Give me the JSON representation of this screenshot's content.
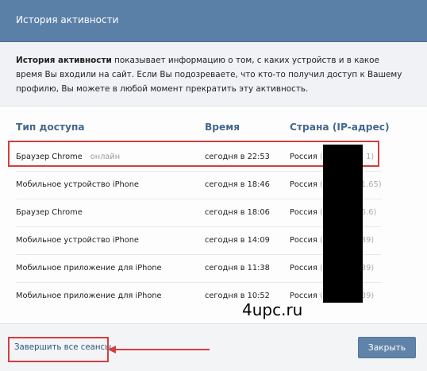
{
  "header": {
    "title": "История активности"
  },
  "info": {
    "bold": "История активности",
    "text": " показывает информацию о том, с каких устройств и в какое время Вы входили на сайт. Если Вы подозреваете, что кто-то получил доступ к Вашему профилю, Вы можете в любой момент прекратить эту активность."
  },
  "table": {
    "headers": {
      "device": "Тип доступа",
      "time": "Время",
      "country": "Страна (IP-адрес)"
    },
    "rows": [
      {
        "device": "Браузер Chrome",
        "status": "онлайн",
        "time": "сегодня в 22:53",
        "country": "Россия",
        "ip_prefix": " (5",
        "ip_suffix": "1)"
      },
      {
        "device": "Мобильное устройство iPhone",
        "status": "",
        "time": "сегодня в 18:46",
        "country": "Россия",
        "ip_prefix": " (",
        "ip_suffix": "1.65)"
      },
      {
        "device": "Браузер Chrome",
        "status": "",
        "time": "сегодня в 18:06",
        "country": "Россия",
        "ip_prefix": " (",
        "ip_suffix": "5.6)"
      },
      {
        "device": "Мобильное устройство iPhone",
        "status": "",
        "time": "сегодня в 14:09",
        "country": "Россия",
        "ip_prefix": " (",
        "ip_suffix": "39)"
      },
      {
        "device": "Мобильное приложение для iPhone",
        "status": "",
        "time": "сегодня в 11:38",
        "country": "Россия",
        "ip_prefix": " (",
        "ip_suffix": "39)"
      },
      {
        "device": "Мобильное приложение для iPhone",
        "status": "",
        "time": "сегодня в 10:52",
        "country": "Россия",
        "ip_prefix": " (",
        "ip_suffix": "39)"
      }
    ]
  },
  "watermark": "4upc.ru",
  "footer": {
    "end_sessions": "Завершить все сеансы",
    "close": "Закрыть"
  },
  "colors": {
    "header": "#5b80a8",
    "column_header": "#45688e",
    "highlight": "#d23f3f",
    "button": "#6083a9"
  }
}
